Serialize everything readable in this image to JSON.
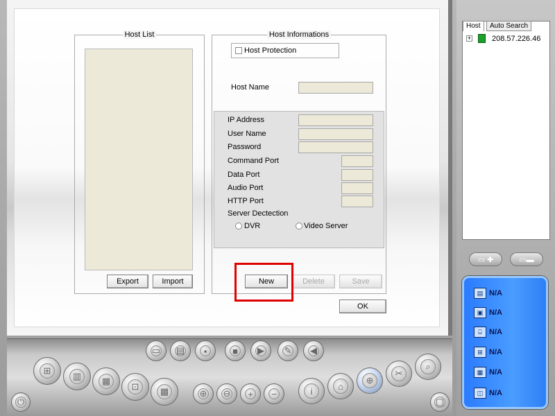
{
  "host_list": {
    "title": "Host List",
    "export_label": "Export",
    "import_label": "Import"
  },
  "host_info": {
    "title": "Host Informations",
    "protection_label": "Host Protection",
    "host_name_label": "Host Name",
    "ip_label": "IP Address",
    "user_label": "User Name",
    "password_label": "Password",
    "command_port_label": "Command Port",
    "data_port_label": "Data Port",
    "audio_port_label": "Audio Port",
    "http_port_label": "HTTP Port",
    "server_detection_label": "Server Dectection",
    "radio_dvr": "DVR",
    "radio_video_server": "Video Server",
    "new_label": "New",
    "delete_label": "Delete",
    "save_label": "Save",
    "ok_label": "OK"
  },
  "tree": {
    "tab_host": "Host",
    "tab_auto_search": "Auto Search",
    "node_expand": "+",
    "node_ip": "208.57.226.46"
  },
  "status": {
    "items": [
      {
        "icon": "hdd-icon",
        "value": "N/A"
      },
      {
        "icon": "camera-network-icon",
        "value": "N/A"
      },
      {
        "icon": "ip-icon",
        "value": "N/A"
      },
      {
        "icon": "network-icon",
        "value": "N/A"
      },
      {
        "icon": "film-icon",
        "value": "N/A"
      },
      {
        "icon": "camera-icon",
        "value": "N/A"
      }
    ]
  },
  "colors": {
    "highlight": "#e00000",
    "status_panel": "#3a8cff",
    "field_bg": "#ece9d8"
  }
}
